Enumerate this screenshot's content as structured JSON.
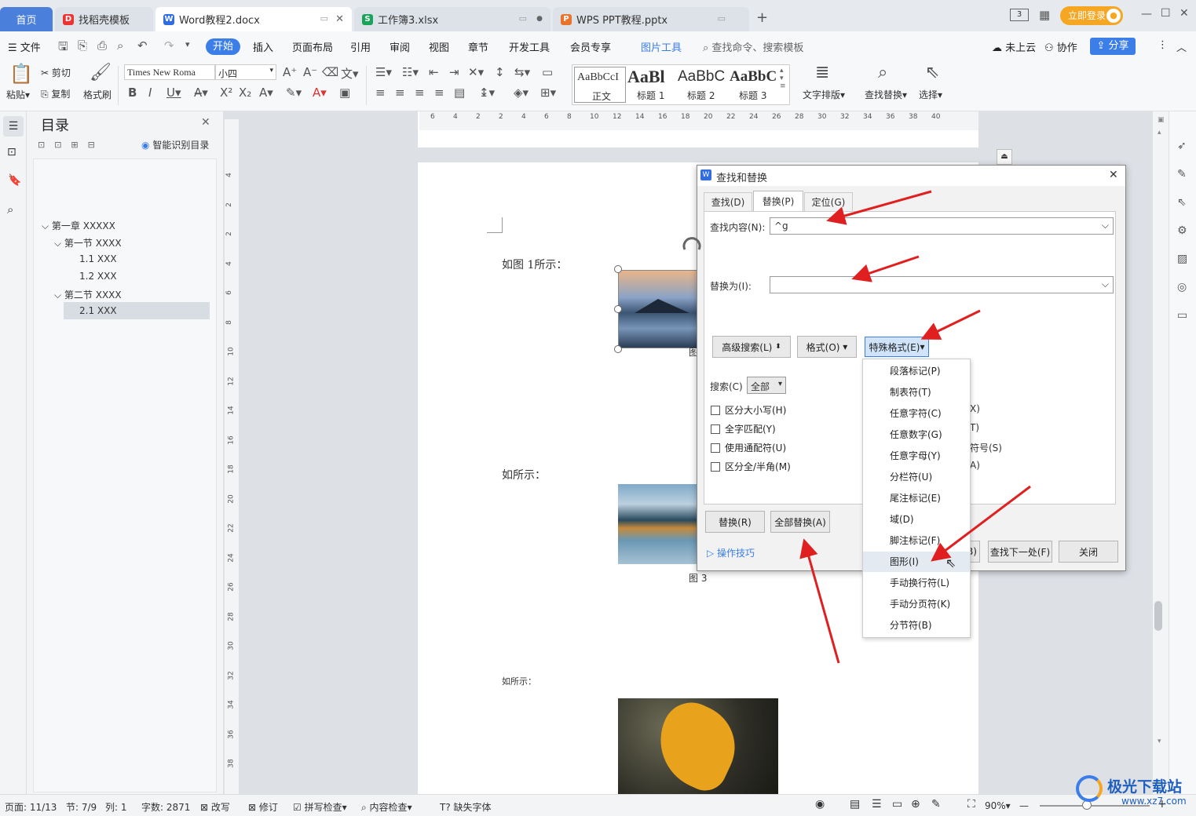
{
  "tabs": [
    {
      "label": "首页"
    },
    {
      "label": "找稻壳模板"
    },
    {
      "label": "Word教程2.docx"
    },
    {
      "label": "工作簿3.xlsx"
    },
    {
      "label": "WPS PPT教程.pptx"
    }
  ],
  "titlebar": {
    "login": "立即登录",
    "page_count": "3"
  },
  "menu": {
    "file": "文件",
    "items": [
      "开始",
      "插入",
      "页面布局",
      "引用",
      "审阅",
      "视图",
      "章节",
      "开发工具",
      "会员专享"
    ],
    "picture_tools": "图片工具",
    "search": "查找命令、搜索模板",
    "cloud": "未上云",
    "collab": "协作",
    "share": "分享"
  },
  "ribbon": {
    "paste": "粘贴",
    "cut": "剪切",
    "copy": "复制",
    "format_painter": "格式刷",
    "font_name": "Times New Roma",
    "font_size": "小四",
    "styles": [
      {
        "preview": "AaBbCcI",
        "name": "正文"
      },
      {
        "preview": "AaBl",
        "name": "标题 1"
      },
      {
        "preview": "AaBbC",
        "name": "标题 2"
      },
      {
        "preview": "AaBbC",
        "name": "标题 3"
      }
    ],
    "text_layout": "文字排版",
    "find_replace": "查找替换",
    "select": "选择"
  },
  "nav": {
    "title": "目录",
    "smart": "智能识别目录",
    "items": [
      {
        "label": "第一章  XXXXX",
        "level": 0
      },
      {
        "label": "第一节  XXXX",
        "level": 1
      },
      {
        "label": "1.1 XXX",
        "level": 2
      },
      {
        "label": "1.2 XXX",
        "level": 2
      },
      {
        "label": "第二节  XXXX",
        "level": 1
      },
      {
        "label": "2.1 XXX",
        "level": 2,
        "selected": true
      }
    ]
  },
  "ruler": [
    "6",
    "4",
    "2",
    "2",
    "4",
    "6",
    "8",
    "10",
    "12",
    "14",
    "16",
    "18",
    "20",
    "22",
    "24",
    "26",
    "28",
    "30",
    "32",
    "34",
    "36",
    "38",
    "40"
  ],
  "vruler": [
    "4",
    "2",
    "2",
    "4",
    "6",
    "8",
    "10",
    "12",
    "14",
    "16",
    "18",
    "20",
    "22",
    "24",
    "26",
    "28",
    "30",
    "32",
    "34",
    "36",
    "38"
  ],
  "doc": {
    "text1": "如图 1所示：",
    "text2": "如所示：",
    "text3": "如所示：",
    "caption_partial": "图",
    "caption3": "图 3"
  },
  "dialog": {
    "title": "查找和替换",
    "tabs": [
      "查找(D)",
      "替换(P)",
      "定位(G)"
    ],
    "find_label": "查找内容(N):",
    "find_value": "^g",
    "replace_label": "替换为(I):",
    "replace_value": "",
    "advanced": "高级搜索(L)",
    "format": "格式(O)",
    "special": "特殊格式(E)",
    "search_label": "搜索(C)",
    "search_value": "全部",
    "checks": [
      "区分大小写(H)",
      "全字匹配(Y)",
      "使用通配符(U)",
      "区分全/半角(M)"
    ],
    "right_partial": [
      "X)",
      "T)",
      "符号(S)",
      "A)"
    ],
    "replace_btn": "替换(R)",
    "replace_all": "全部替换(A)",
    "tips": "操作技巧",
    "partial_btn": "B)",
    "find_next": "查找下一处(F)",
    "close": "关闭"
  },
  "special_menu": [
    "段落标记(P)",
    "制表符(T)",
    "任意字符(C)",
    "任意数字(G)",
    "任意字母(Y)",
    "分栏符(U)",
    "尾注标记(E)",
    "域(D)",
    "脚注标记(F)",
    "图形(I)",
    "手动换行符(L)",
    "手动分页符(K)",
    "分节符(B)"
  ],
  "status": {
    "page": "页面: 11/13",
    "section": "节: 7/9",
    "col": "列: 1",
    "words": "字数: 2871",
    "rewrite": "改写",
    "revise": "修订",
    "spell": "拼写检查",
    "content": "内容检查",
    "missing_font": "缺失字体",
    "zoom": "90%"
  },
  "watermark": {
    "name": "极光下载站",
    "url": "www.xz7.com"
  },
  "colors": {
    "accent": "#3b7ee8",
    "tab_active": "#ffffff",
    "login": "#f5a623",
    "arrow": "#e02020"
  }
}
